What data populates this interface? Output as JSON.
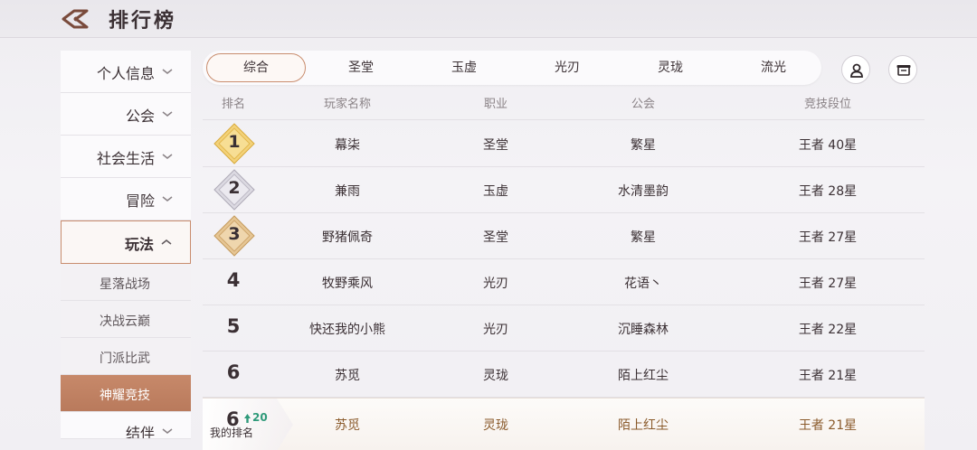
{
  "header": {
    "title": "排行榜"
  },
  "sidebar": {
    "items": [
      {
        "label": "个人信息"
      },
      {
        "label": "公会"
      },
      {
        "label": "社会生活"
      },
      {
        "label": "冒险"
      },
      {
        "label": "玩法"
      }
    ],
    "subitems": [
      {
        "label": "星落战场"
      },
      {
        "label": "决战云巅"
      },
      {
        "label": "门派比武"
      },
      {
        "label": "神耀竞技"
      }
    ],
    "cut_item": {
      "label": "结伴"
    }
  },
  "tabs": [
    {
      "label": "综合"
    },
    {
      "label": "圣堂"
    },
    {
      "label": "玉虚"
    },
    {
      "label": "光刃"
    },
    {
      "label": "灵珑"
    },
    {
      "label": "流光"
    }
  ],
  "table": {
    "headers": {
      "rank": "排名",
      "name": "玩家名称",
      "job": "职业",
      "guild": "公会",
      "tier": "竞技段位"
    },
    "rows": [
      {
        "rank": "1",
        "name": "幕柒",
        "job": "圣堂",
        "guild": "繁星",
        "tier": "王者 40星"
      },
      {
        "rank": "2",
        "name": "兼雨",
        "job": "玉虚",
        "guild": "水清墨韵",
        "tier": "王者 28星"
      },
      {
        "rank": "3",
        "name": "野猪佩奇",
        "job": "圣堂",
        "guild": "繁星",
        "tier": "王者 27星"
      },
      {
        "rank": "4",
        "name": "牧野乘风",
        "job": "光刃",
        "guild": "花语丶",
        "tier": "王者 27星"
      },
      {
        "rank": "5",
        "name": "快还我的小熊",
        "job": "光刃",
        "guild": "沉睡森林",
        "tier": "王者 22星"
      },
      {
        "rank": "6",
        "name": "苏觅",
        "job": "灵珑",
        "guild": "陌上红尘",
        "tier": "王者 21星"
      }
    ]
  },
  "my_rank": {
    "rank": "6",
    "change": "20",
    "label": "我的排名",
    "name": "苏觅",
    "job": "灵珑",
    "guild": "陌上红尘",
    "tier": "王者 21星"
  },
  "colors": {
    "accent": "#c98d6e",
    "active_sub": "#c0826a",
    "gold": "#e8c15a",
    "silver": "#c9c6d0",
    "bronze": "#d9b078",
    "up": "#2f9a7a"
  }
}
